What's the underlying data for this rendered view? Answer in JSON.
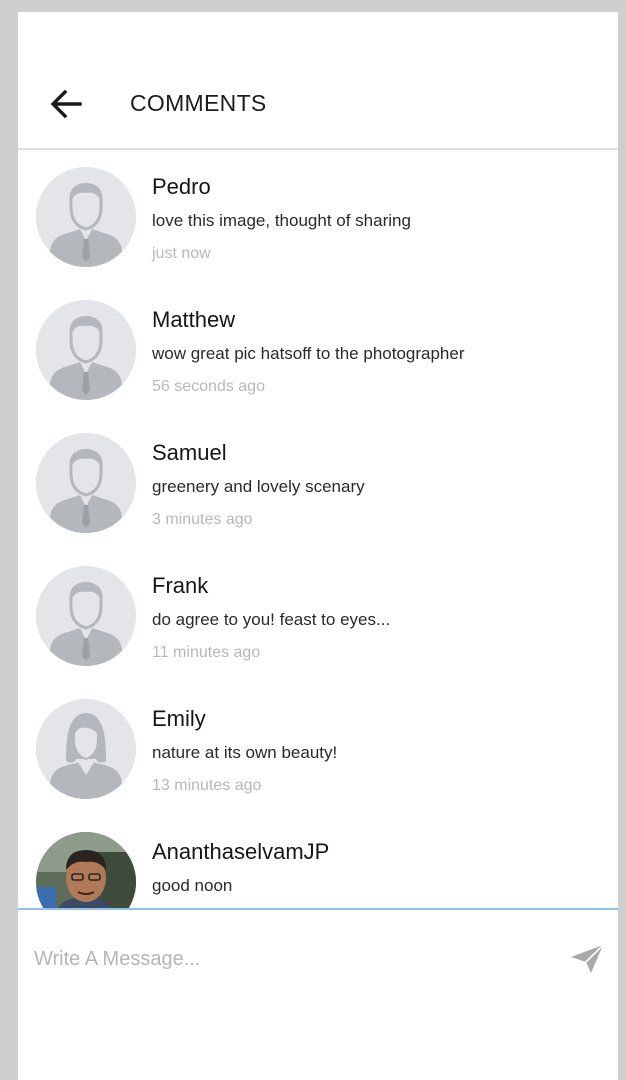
{
  "header": {
    "title": "COMMENTS"
  },
  "comments": [
    {
      "name": "Pedro",
      "text": "love this image, thought of sharing",
      "time": "just now",
      "avatar": "male-silhouette"
    },
    {
      "name": "Matthew",
      "text": "wow great pic hatsoff to the photographer",
      "time": "56 seconds ago",
      "avatar": "male-silhouette"
    },
    {
      "name": "Samuel",
      "text": "greenery and lovely scenary",
      "time": "3 minutes ago",
      "avatar": "male-silhouette"
    },
    {
      "name": "Frank",
      "text": "do agree to you! feast to eyes...",
      "time": "11 minutes ago",
      "avatar": "male-silhouette"
    },
    {
      "name": "Emily",
      "text": "nature at its own beauty!",
      "time": "13 minutes ago",
      "avatar": "female-silhouette"
    },
    {
      "name": "AnanthaselvamJP",
      "text": "good noon",
      "time": "",
      "avatar": "photo"
    }
  ],
  "composer": {
    "placeholder": "Write A Message..."
  },
  "colors": {
    "accent_line": "#8fc1ea",
    "avatar_bg": "#e3e5e8",
    "avatar_fg": "#b4b8bd"
  }
}
